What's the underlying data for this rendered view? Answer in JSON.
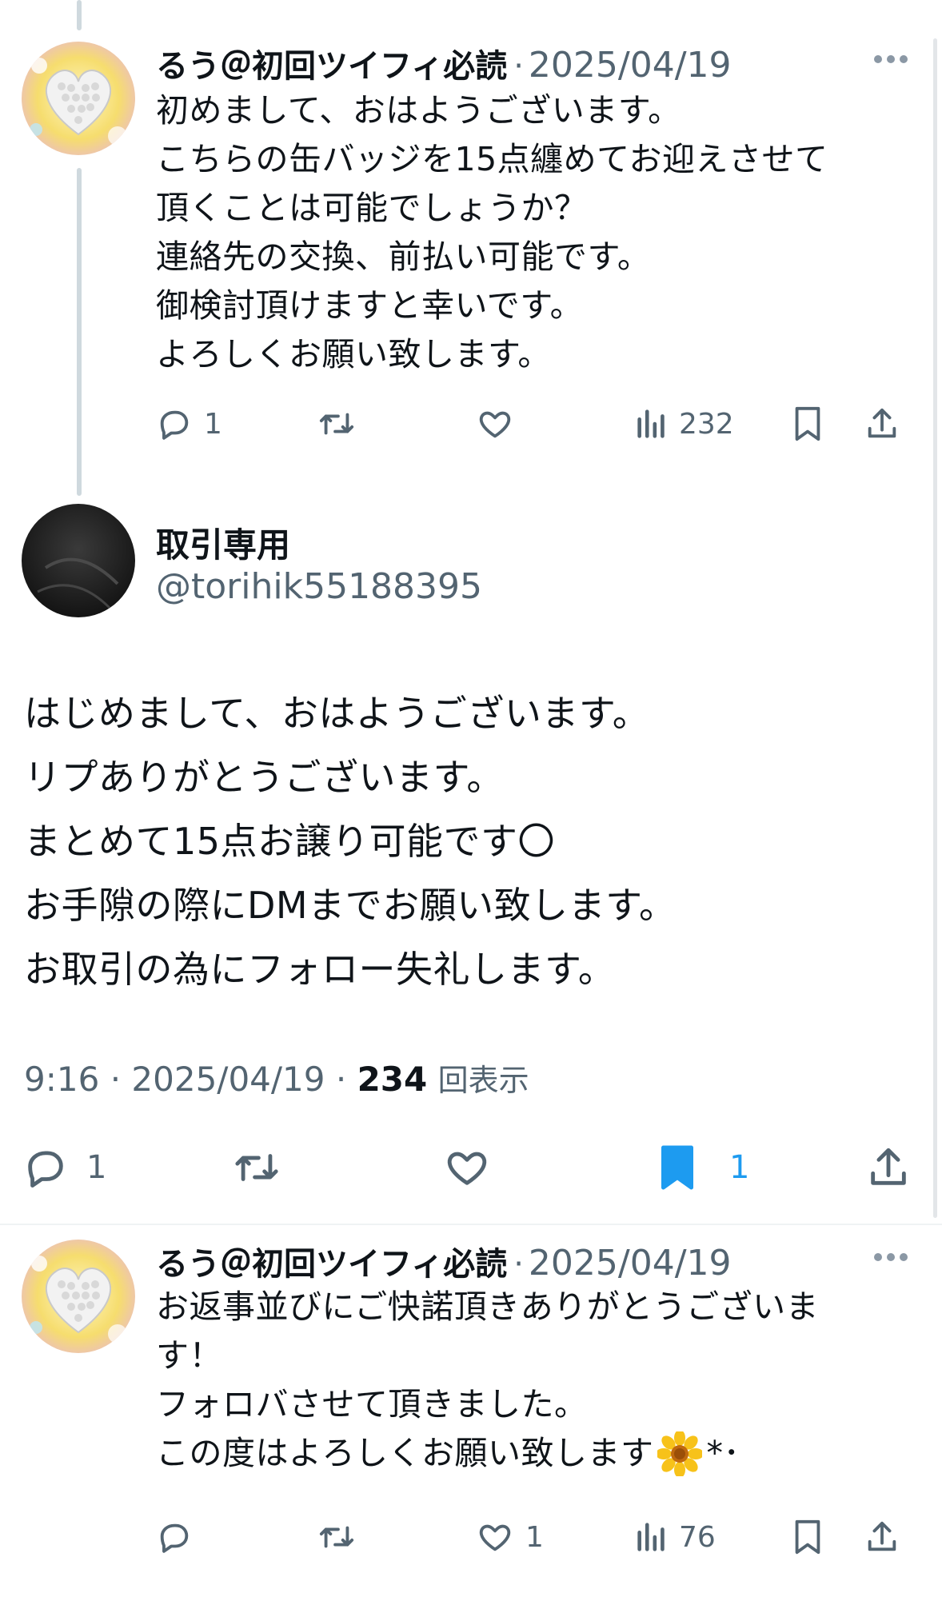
{
  "reply1": {
    "display_name": "るう＠初回ツイフィ必読",
    "separator": "·",
    "date": "2025/04/19",
    "text_lines": [
      "初めまして、おはようございます。",
      "こちらの缶バッジを15点纏めてお迎えさせて",
      "頂くことは可能でしょうか？",
      "連絡先の交換、前払い可能です。",
      "御検討頂けますと幸いです。",
      "よろしくお願い致します。"
    ],
    "reply_count": "1",
    "retweet_count": "",
    "like_count": "",
    "view_count": "232"
  },
  "main": {
    "display_name": "取引専用",
    "handle": "@torihik55188395",
    "text_lines": [
      "はじめまして、おはようございます。",
      "リプありがとうございます。",
      "まとめて15点お譲り可能です〇",
      "お手隙の際にDMまでお願い致します。",
      "お取引の為にフォロー失礼します。"
    ],
    "time": "9:16",
    "date": "2025/04/19",
    "separator": "·",
    "views": "234",
    "views_label": "回表示",
    "reply_count": "1",
    "bookmark_count": "1"
  },
  "reply2": {
    "display_name": "るう＠初回ツイフィ必読",
    "separator": "·",
    "date": "2025/04/19",
    "text_lines": [
      "お返事並びにご快諾頂きありがとうございま",
      "す！",
      "フォロバさせて頂きました。",
      "この度はよろしくお願い致します"
    ],
    "text_suffix": "*･",
    "emoji": "sunflower-emoji",
    "reply_count": "",
    "like_count": "1",
    "view_count": "76"
  },
  "icons": {
    "reply": "speech-bubble-icon",
    "retweet": "retweet-icon",
    "like": "heart-icon",
    "views": "bar-chart-icon",
    "bookmark": "bookmark-icon",
    "share": "share-icon",
    "more": "ellipsis-icon"
  },
  "colors": {
    "text": "#0f1419",
    "secondary": "#536471",
    "accent": "#1d9bf0",
    "thread_line": "#cfd9de"
  }
}
